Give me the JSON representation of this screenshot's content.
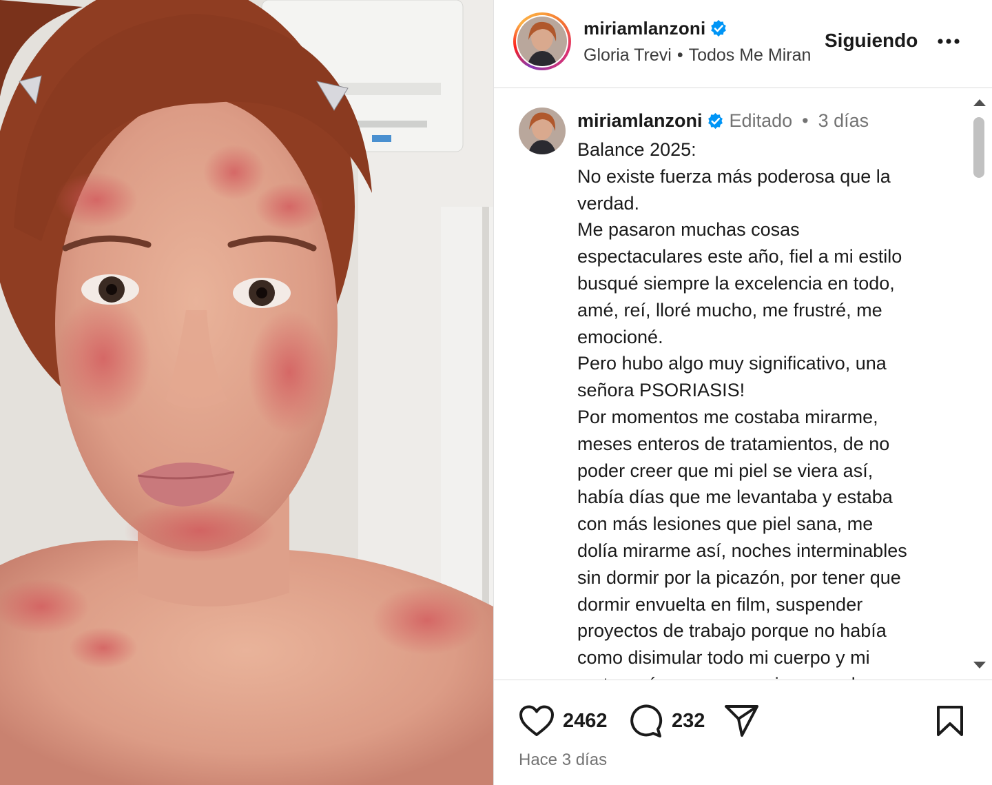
{
  "header": {
    "username": "miriamlanzoni",
    "music_artist": "Gloria Trevi",
    "music_separator": "•",
    "music_song": "Todos Me Miran",
    "follow_label": "Siguiendo",
    "more_icon": "more-horizontal-icon",
    "verified_color": "#0095f6"
  },
  "caption": {
    "username": "miriamlanzoni",
    "edited_label": "Editado",
    "separator": "•",
    "time": "3 días",
    "lines": [
      "Balance 2025:",
      "No existe fuerza más poderosa que la",
      "verdad.",
      "Me pasaron muchas cosas",
      "espectaculares este año, fiel a mi estilo",
      "busqué siempre la excelencia en todo,",
      "amé, reí, lloré mucho, me frustré, me",
      "emocioné.",
      "Pero hubo algo muy significativo, una",
      "señora PSORIASIS!",
      "Por momentos me costaba mirarme,",
      "meses enteros de tratamientos, de no",
      "poder creer que mi piel se viera así,",
      "había días que me levantaba y estaba",
      "con más lesiones que piel sana, me",
      "dolía mirarme así, noches interminables",
      "sin dormir por la picazón, por tener que",
      "dormir envuelta en film, suspender",
      "proyectos de trabajo porque no había",
      "como disimular todo mi cuerpo y mi",
      "rostro así, y porque era impensado"
    ]
  },
  "actions": {
    "like_icon": "heart-icon",
    "likes": "2462",
    "comment_icon": "comment-icon",
    "comments": "232",
    "share_icon": "send-icon",
    "save_icon": "bookmark-icon",
    "posted": "Hace 3 días"
  }
}
